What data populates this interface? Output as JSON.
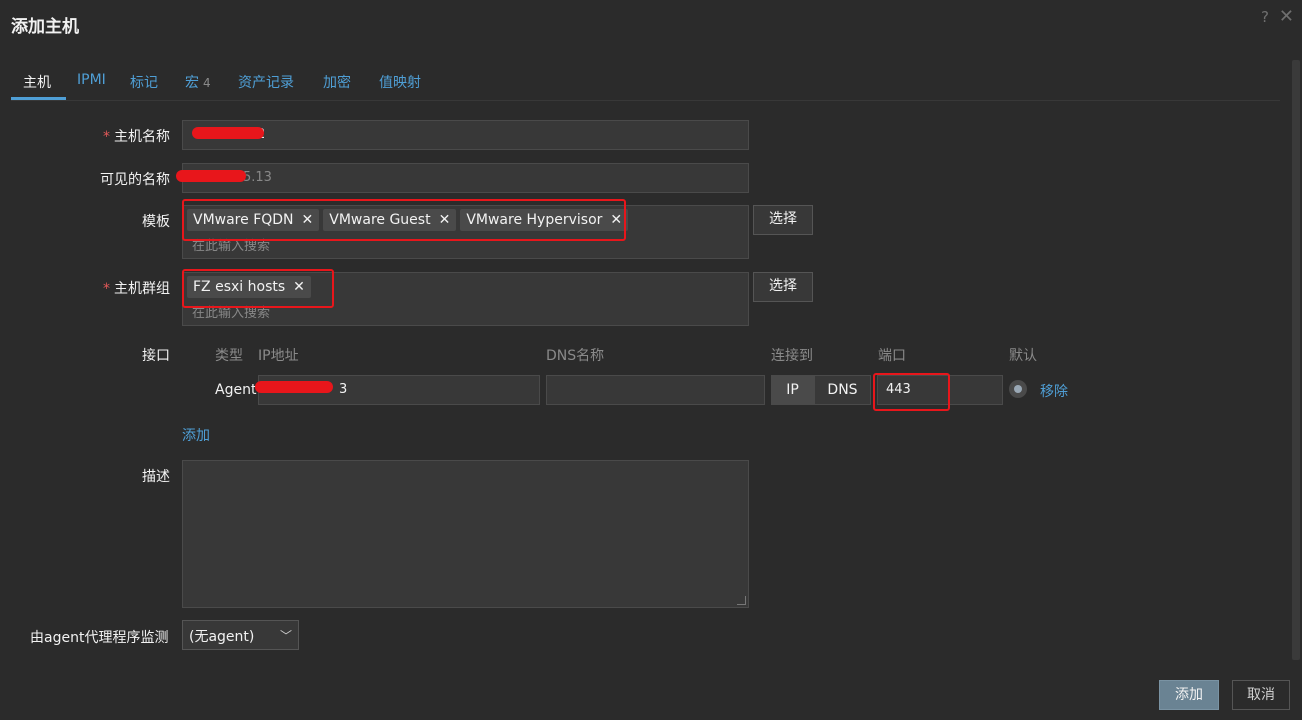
{
  "dialog": {
    "title": "添加主机",
    "help_icon": "question-mark-icon",
    "close_icon": "close-icon"
  },
  "tabs": [
    {
      "label": "主机",
      "active": true
    },
    {
      "label": "IPMI"
    },
    {
      "label": "标记"
    },
    {
      "label": "宏",
      "count": "4"
    },
    {
      "label": "资产记录"
    },
    {
      "label": "加密"
    },
    {
      "label": "值映射"
    }
  ],
  "form": {
    "host_name": {
      "label": "主机名称",
      "required": true,
      "value": "2"
    },
    "visible_name": {
      "label": "可见的名称",
      "value": "5.13"
    },
    "templates": {
      "label": "模板",
      "chips": [
        "VMware FQDN",
        "VMware Guest",
        "VMware Hypervisor"
      ],
      "placeholder": "在此输入搜索",
      "select_label": "选择"
    },
    "host_groups": {
      "label": "主机群组",
      "required": true,
      "chips": [
        "FZ esxi hosts"
      ],
      "placeholder": "在此输入搜索",
      "select_label": "选择"
    },
    "interfaces": {
      "label": "接口",
      "headers": {
        "type": "类型",
        "ip": "IP地址",
        "dns": "DNS名称",
        "connect_to": "连接到",
        "port": "端口",
        "default": "默认"
      },
      "rows": [
        {
          "type": "Agent",
          "ip": "3",
          "dns": "",
          "connect_ip": "IP",
          "connect_dns": "DNS",
          "port": "443",
          "remove_label": "移除"
        }
      ],
      "add_label": "添加"
    },
    "description": {
      "label": "描述",
      "value": ""
    },
    "monitored_by_proxy": {
      "label": "由agent代理程序监测",
      "value": "(无agent)"
    }
  },
  "footer": {
    "add_label": "添加",
    "cancel_label": "取消"
  },
  "colors": {
    "background": "#2b2b2b",
    "field": "#383838",
    "accent": "#4f9fd6",
    "required": "#e45959",
    "annotation": "#e8161b",
    "primary_button": "#6a8393"
  }
}
